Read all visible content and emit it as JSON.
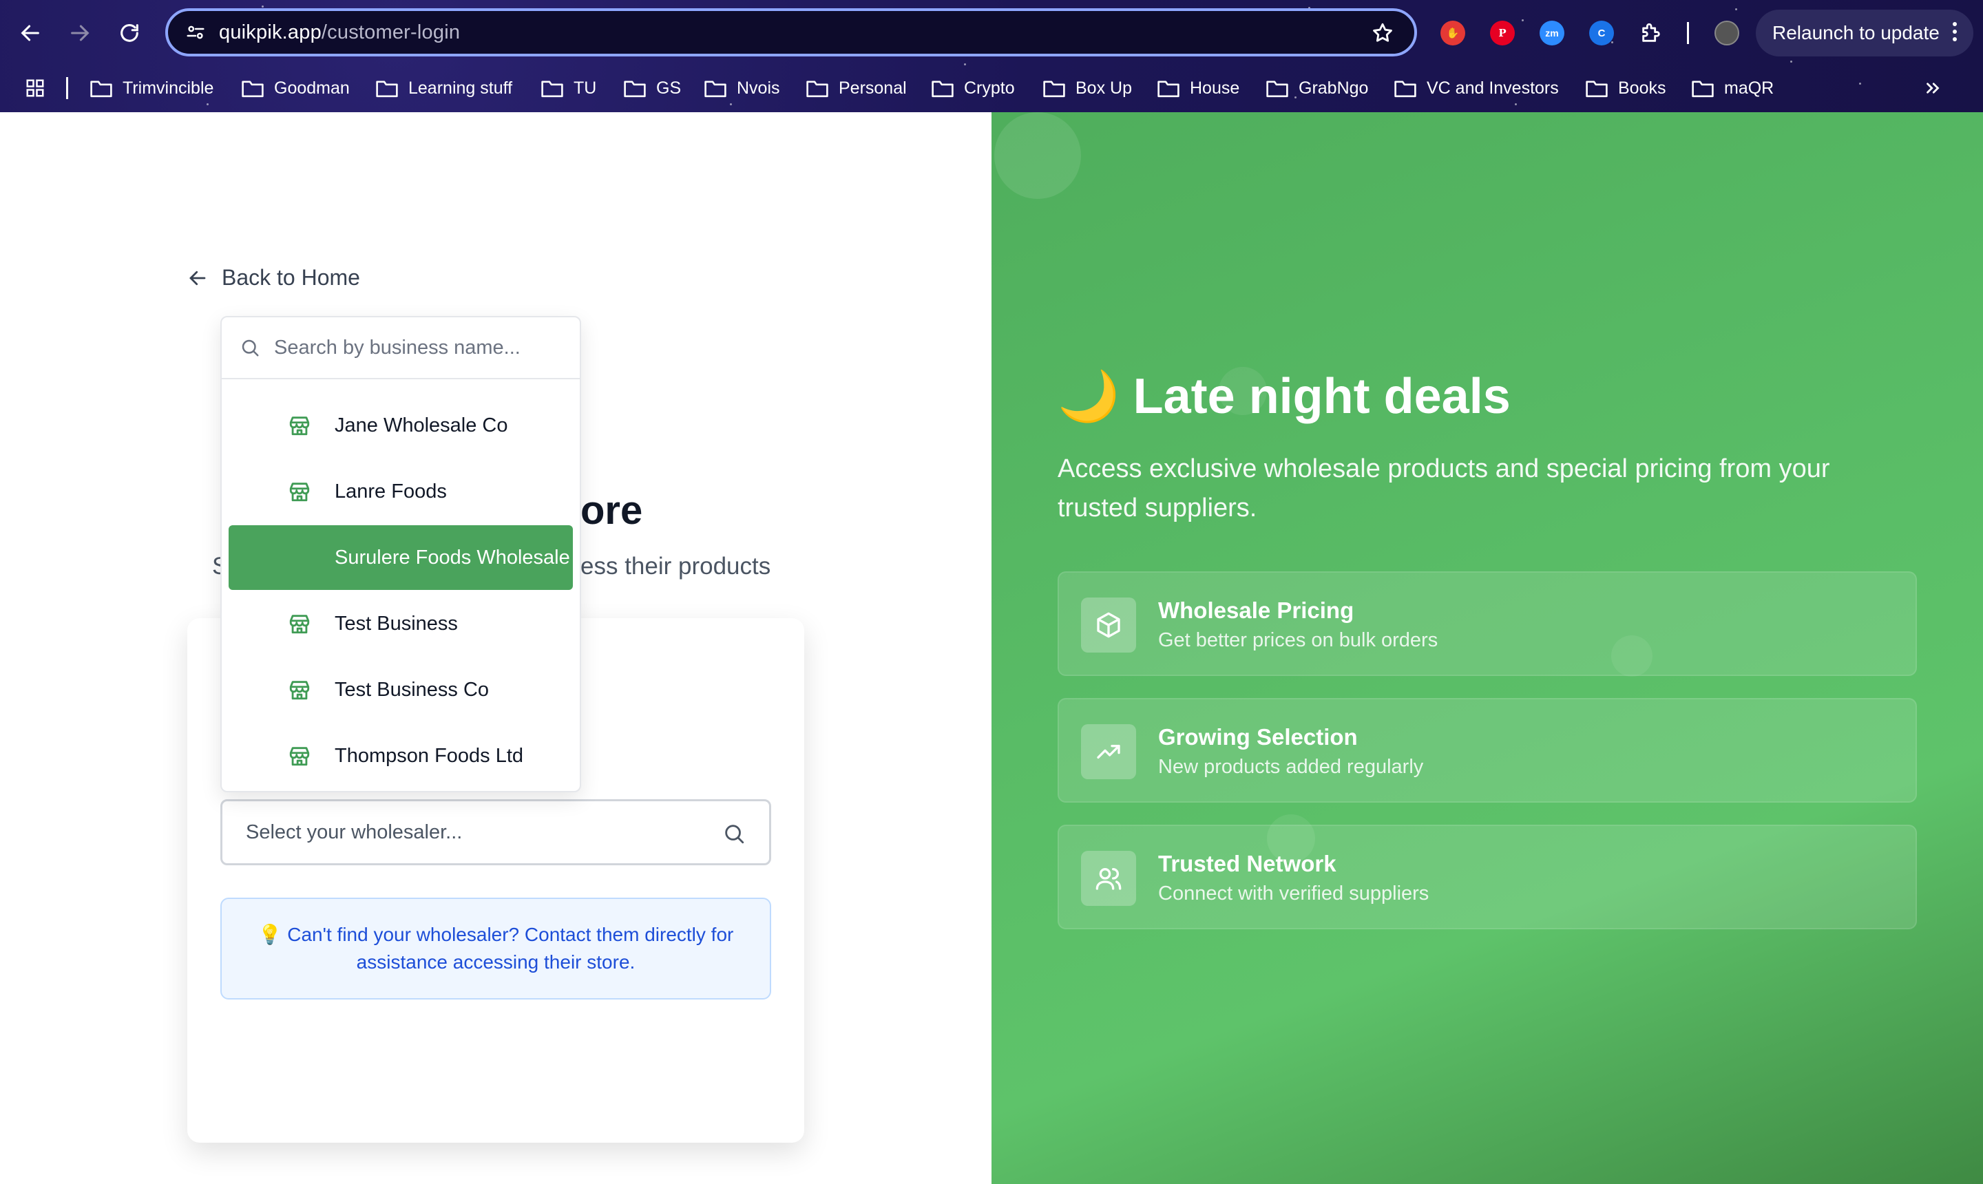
{
  "browser": {
    "url_host": "quikpik.app",
    "url_path": "/customer-login",
    "relaunch_label": "Relaunch to update",
    "extensions": [
      "adblock-icon",
      "pinterest-icon",
      "zoom-icon",
      "extension-c-icon",
      "puzzle-icon"
    ],
    "bookmarks": [
      "Trimvincible",
      "Goodman",
      "Learning stuff",
      "TU",
      "GS",
      "Nvois",
      "Personal",
      "Crypto",
      "Box Up",
      "House",
      "GrabNgo",
      "VC and Investors",
      "Books",
      "maQR"
    ]
  },
  "left": {
    "back_label": "Back to Home",
    "heading_partial": "ore",
    "subtext_left_partial": "S",
    "subtext_right_partial": "ess their products",
    "dropdown": {
      "search_placeholder": "Search by business name...",
      "items": [
        {
          "label": "Jane Wholesale Co",
          "active": false
        },
        {
          "label": "Lanre Foods",
          "active": false
        },
        {
          "label": "Surulere Foods Wholesale",
          "active": true
        },
        {
          "label": "Test Business",
          "active": false
        },
        {
          "label": "Test Business Co",
          "active": false
        },
        {
          "label": "Thompson Foods Ltd",
          "active": false
        }
      ]
    },
    "select_placeholder": "Select your wholesaler...",
    "notice": "💡 Can't find your wholesaler? Contact them directly for assistance accessing their store."
  },
  "right": {
    "title": "🌙 Late night deals",
    "subtitle": "Access exclusive wholesale products and special pricing from your trusted suppliers.",
    "features": [
      {
        "title": "Wholesale Pricing",
        "desc": "Get better prices on bulk orders",
        "icon": "package-icon"
      },
      {
        "title": "Growing Selection",
        "desc": "New products added regularly",
        "icon": "trending-up-icon"
      },
      {
        "title": "Trusted Network",
        "desc": "Connect with verified suppliers",
        "icon": "users-icon"
      }
    ]
  },
  "colors": {
    "accent_green": "#4aa35c",
    "panel_green": "#59bc66",
    "notice_blue": "#1d4ed8",
    "chrome_bg": "#1c1656"
  }
}
